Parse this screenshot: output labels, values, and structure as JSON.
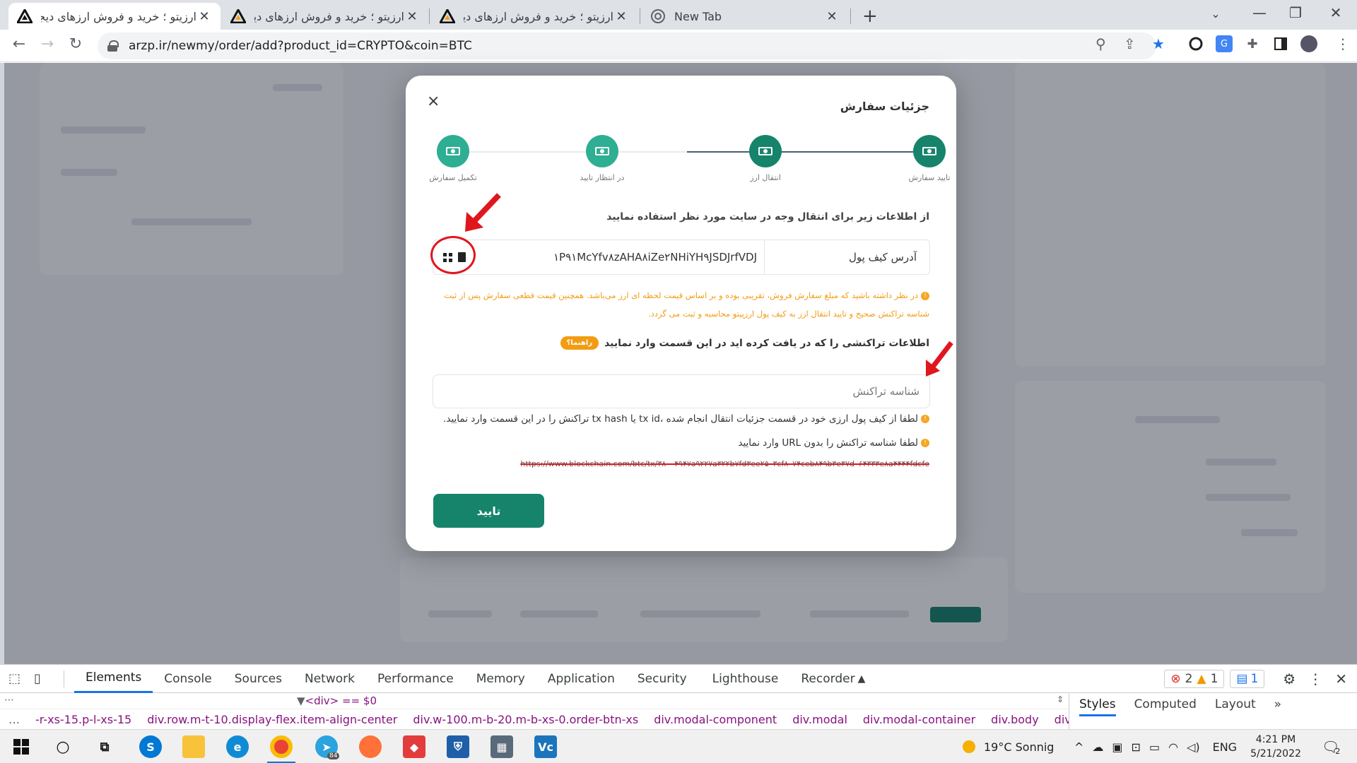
{
  "browser": {
    "tabs": [
      {
        "title": "ارزیتو ؛ خرید و فروش ارزهای دیجیتا",
        "active": true
      },
      {
        "title": "ارزیتو ؛ خرید و فروش ارزهای دیجیتا",
        "active": false
      },
      {
        "title": "ارزیتو ؛ خرید و فروش ارزهای دیجیتا",
        "active": false
      },
      {
        "title": "New Tab",
        "active": false
      }
    ],
    "url": "arzp.ir/newmy/order/add?product_id=CRYPTO&coin=BTC"
  },
  "modal": {
    "close_glyph": "×",
    "title": "جزئیات سفارش",
    "steps": [
      {
        "label": "تایید سفارش",
        "state": "done"
      },
      {
        "label": "انتقال ارز",
        "state": "current"
      },
      {
        "label": "در انتظار تایید",
        "state": "pending"
      },
      {
        "label": "تکمیل سفارش",
        "state": "pending"
      }
    ],
    "instruction": "از اطلاعات زیر برای انتقال وجه در سایت مورد نظر استفاده نمایید",
    "wallet": {
      "label": "آدرس کیف پول",
      "address": "۱P۹۱McYfv۸zAHA۸iZe۲NHiYH۹JSDJrfVDJ"
    },
    "warning_line1": "در نظر داشته باشید که مبلغ سفارش فروش، تقریبی بوده و بر اساس قیمت لحظه ای ارز می‌باشد. همچنین قیمت قطعی سفارش پس از ثبت",
    "warning_line2": "شناسه تراکنش صحیح و تایید انتقال ارز به کیف پول ارزپیتو محاسبه و ثبت می گردد.",
    "tx_title": "اطلاعات تراکنشی را که در یافت کرده اید در این قسمت وارد نمایید",
    "guide_badge": "راهنما؟",
    "tx_placeholder": "شناسه تراکنش",
    "note1": "لطفا از کیف پول ارزی خود در قسمت جزئیات انتقال انجام شده ،tx id یا tx hash تراکنش را در این قسمت وارد نمایید.",
    "note2": "لطفا شناسه تراکنش را بدون URL وارد نمایید",
    "example_url": "https://www.blockchain.com/btc/tx/۳۸۰۰۴۹۴۷a۹۲۲۷a۳۲۲b۷fd۳ee۲۵۰۳cf۸۰۷۴ceb۸۴۹b۳e۳۷d۰۶۴۳۳۳e۸a۴۴۴۴fdcfe",
    "confirm_label": "تایید"
  },
  "devtools": {
    "tabs": [
      "Elements",
      "Console",
      "Sources",
      "Network",
      "Performance",
      "Memory",
      "Application",
      "Security",
      "Lighthouse",
      "Recorder"
    ],
    "errors": "2",
    "warnings": "1",
    "messages": "1",
    "selected_node": "<div> == $0",
    "breadcrumbs": [
      "-r-xs-15.p-l-xs-15",
      "div.row.m-t-10.display-flex.item-align-center",
      "div.w-100.m-b-20.m-b-xs-0.order-btn-xs",
      "div.modal-component",
      "div.modal",
      "div.modal-container",
      "div.body",
      "div.order",
      "div"
    ],
    "side_tabs": [
      "Styles",
      "Computed",
      "Layout"
    ]
  },
  "taskbar": {
    "weather": "19°C  Sonnig",
    "lang": "ENG",
    "time": "4:21 PM",
    "date": "5/21/2022",
    "notifications": "2",
    "telegram_badge": "84"
  },
  "colors": {
    "accent_green": "#15846b",
    "step_done": "#15846b",
    "step_pending": "#2eae93",
    "warning_orange": "#f39c12",
    "annotation_red": "#e0161e"
  }
}
